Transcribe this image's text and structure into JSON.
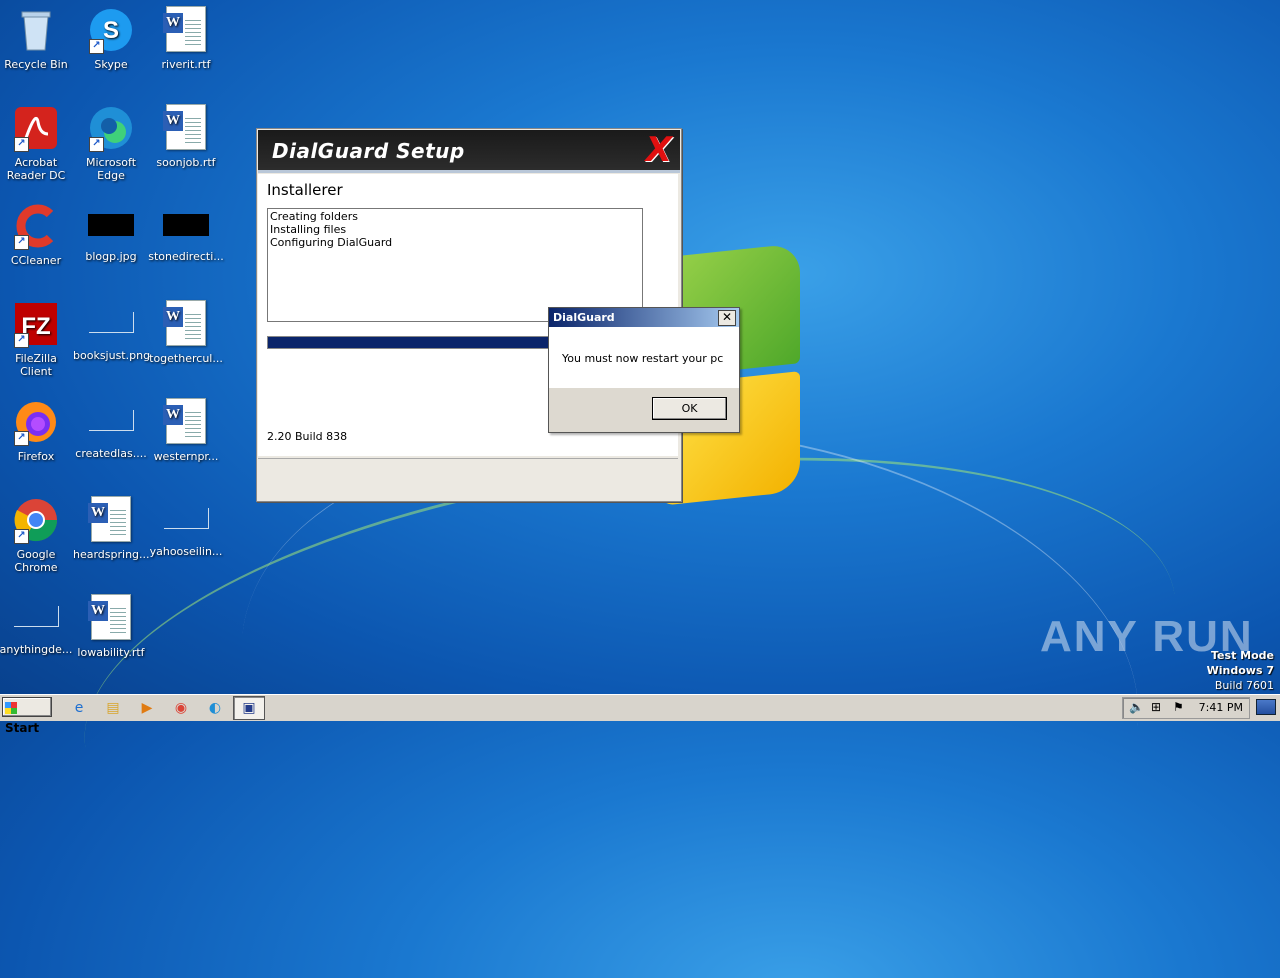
{
  "desktop": {
    "icons": [
      {
        "label": "Recycle Bin",
        "icon": "recycle-bin-icon"
      },
      {
        "label": "Skype",
        "icon": "skype-icon"
      },
      {
        "label": "riverit.rtf",
        "icon": "word-doc-icon"
      },
      {
        "label": "Acrobat Reader DC",
        "icon": "acrobat-icon"
      },
      {
        "label": "Microsoft Edge",
        "icon": "edge-icon"
      },
      {
        "label": "soonjob.rtf",
        "icon": "word-doc-icon"
      },
      {
        "label": "CCleaner",
        "icon": "ccleaner-icon"
      },
      {
        "label": "blogp.jpg",
        "icon": "image-file-icon"
      },
      {
        "label": "stonedirecti...",
        "icon": "image-file-icon"
      },
      {
        "label": "FileZilla Client",
        "icon": "filezilla-icon"
      },
      {
        "label": "booksjust.png",
        "icon": "image-file-icon"
      },
      {
        "label": "togethercul...",
        "icon": "word-doc-icon"
      },
      {
        "label": "Firefox",
        "icon": "firefox-icon"
      },
      {
        "label": "createdlas....",
        "icon": "file-icon"
      },
      {
        "label": "westernpr...",
        "icon": "word-doc-icon"
      },
      {
        "label": "Google Chrome",
        "icon": "chrome-icon"
      },
      {
        "label": "heardspring...",
        "icon": "word-doc-icon"
      },
      {
        "label": "yahooseilin...",
        "icon": "file-icon"
      },
      {
        "label": "anythingde...",
        "icon": "file-icon"
      },
      {
        "label": "lowability.rtf",
        "icon": "word-doc-icon"
      }
    ]
  },
  "setup_window": {
    "banner_title": "DialGuard Setup",
    "heading": "Installerer",
    "log": [
      "Creating folders",
      "Installing files",
      "Configuring DialGuard"
    ],
    "progress": 0.75,
    "version": "2.20 Build 838"
  },
  "dialog": {
    "title": "DialGuard",
    "message": "You must now restart your pc",
    "ok_label": "OK",
    "close_glyph": "✕"
  },
  "watermark": {
    "brand": "ANY RUN",
    "test_mode": "Test Mode",
    "os": "Windows 7",
    "build": "Build 7601"
  },
  "taskbar": {
    "start_label": "Start",
    "clock": "7:41 PM",
    "apps": [
      "ie-icon",
      "explorer-icon",
      "media-player-icon",
      "chrome-icon",
      "edge-icon",
      "dialguard-setup-icon"
    ]
  }
}
